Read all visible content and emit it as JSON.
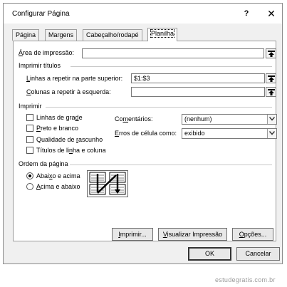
{
  "window": {
    "title": "Configurar Página",
    "help_glyph": "?",
    "close_glyph": "✕"
  },
  "tabs": [
    {
      "label": "Página"
    },
    {
      "label": "Margens"
    },
    {
      "label": "Cabeçalho/rodapé"
    },
    {
      "label": "Planilha",
      "active": true
    }
  ],
  "print_area": {
    "label_prefix": "Á",
    "label_rest": "rea de impressão:",
    "value": ""
  },
  "print_titles": {
    "section": "Imprimir títulos",
    "rows_label_prefix": "L",
    "rows_label_rest": "inhas a repetir na parte superior:",
    "rows_value": "$1:$3",
    "cols_label_prefix": "C",
    "cols_label_rest": "olunas a repetir à esquerda:",
    "cols_value": ""
  },
  "print": {
    "section": "Imprimir",
    "gridlines": {
      "pre": "Linhas de gra",
      "u": "d",
      "post": "e",
      "checked": false
    },
    "black_white": {
      "pre": "",
      "u": "P",
      "post": "reto e branco",
      "checked": false
    },
    "draft": {
      "pre": "Qualidade de ",
      "u": "r",
      "post": "ascunho",
      "checked": false
    },
    "headings": {
      "pre": "Títulos de li",
      "u": "n",
      "post": "ha e coluna",
      "checked": false
    },
    "comments_label_pre": "Co",
    "comments_label_u": "m",
    "comments_label_post": "entários:",
    "comments_value": "(nenhum)",
    "errors_label_u": "E",
    "errors_label_post": "rros de célula como:",
    "errors_value": "exibido"
  },
  "page_order": {
    "section": "Ordem da página",
    "down_then_over": {
      "pre": "Abai",
      "u": "x",
      "post": "o e acima",
      "selected": true
    },
    "over_then_down": {
      "pre": "",
      "u": "A",
      "post": "cima e abaixo",
      "selected": false
    }
  },
  "buttons": {
    "print": {
      "u": "I",
      "post": "mprimir..."
    },
    "preview": {
      "u": "V",
      "post": "isualizar Impressão"
    },
    "options": {
      "u": "O",
      "post": "pções..."
    },
    "ok": "OK",
    "cancel": "Cancelar"
  },
  "watermark": "estudegratis.com.br",
  "icons": {
    "ref": "collapse-dialog-icon",
    "dropdown": "chevron-down-icon"
  }
}
